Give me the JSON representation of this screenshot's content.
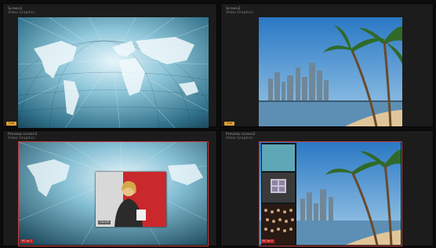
{
  "quadrants": {
    "top_left": {
      "line1": "Screen1",
      "line2": "Video Graphics"
    },
    "top_right": {
      "line1": "Screen2",
      "line2": "Video Graphics"
    },
    "bottom_left": {
      "line1": "Preview screen1",
      "line2": "Video Graphics",
      "tag": "PC to 1"
    },
    "bottom_right": {
      "line1": "Preview screen2",
      "line2": "Video Graphics",
      "tag": "PC to 2"
    }
  },
  "badges": {
    "tl": "Cue",
    "tr": "Cue"
  },
  "pip": {
    "tag": "ON AIR"
  },
  "colors": {
    "tally_red": "#c83a3a",
    "cue_orange": "#e2a230",
    "bg": "#1c1c1c"
  }
}
